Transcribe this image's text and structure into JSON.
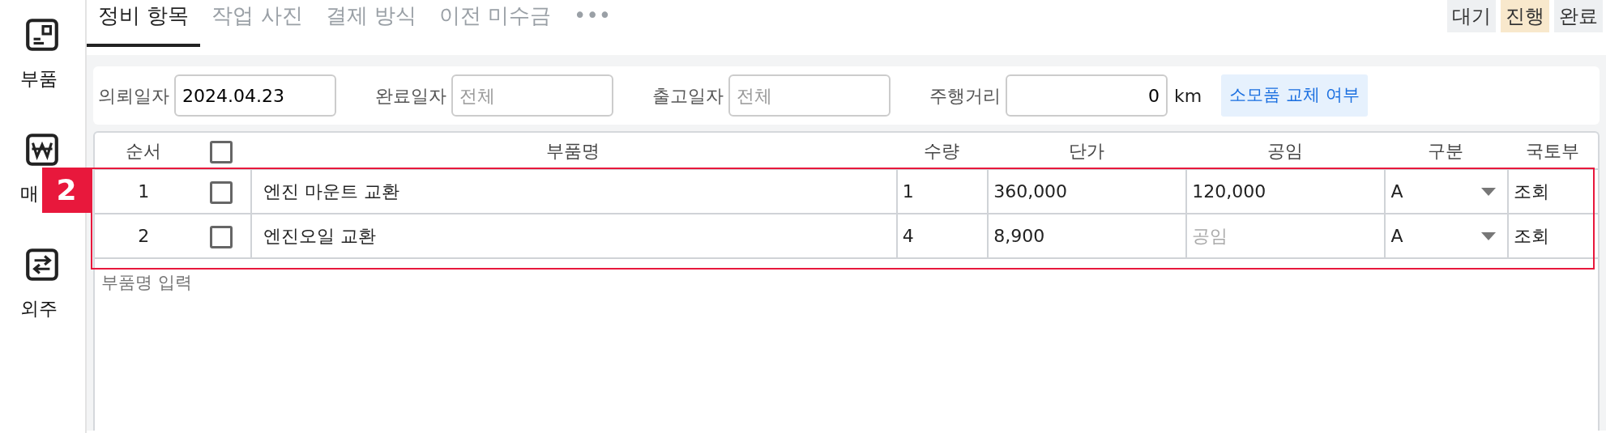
{
  "sidebar": {
    "items": [
      {
        "label": "부품",
        "kind": "part"
      },
      {
        "label": "매",
        "kind": "won"
      },
      {
        "label": "외주",
        "kind": "swap"
      }
    ]
  },
  "tabs": [
    {
      "label": "정비 항목",
      "selected": true
    },
    {
      "label": "작업 사진",
      "selected": false
    },
    {
      "label": "결제 방식",
      "selected": false
    },
    {
      "label": "이전 미수금",
      "selected": false
    },
    {
      "label": "•••",
      "selected": false
    }
  ],
  "status_buttons": [
    {
      "label": "대기",
      "selected": false
    },
    {
      "label": "진행",
      "selected": true
    },
    {
      "label": "완료",
      "selected": false
    }
  ],
  "filters": [
    {
      "label": "의뢰일자",
      "value": "2024.04.23"
    },
    {
      "label": "완료일자",
      "placeholder": "전체"
    },
    {
      "label": "출고일자",
      "placeholder": "전체"
    },
    {
      "label": "주행거리",
      "value": "0",
      "unit": "km"
    }
  ],
  "consumable_button": "소모품 교체 여부",
  "table": {
    "columns": [
      "순서",
      "부품명",
      "수량",
      "단가",
      "공임",
      "구분",
      "국토부"
    ],
    "header_checked": false,
    "rows": [
      {
        "order": "1",
        "checked": false,
        "name": "엔진 마운트 교환",
        "qty": "1",
        "price": "360,000",
        "labor": "120,000",
        "type": "A",
        "ministry": "조회"
      },
      {
        "order": "2",
        "checked": false,
        "name": "엔진오일 교환",
        "qty": "4",
        "price": "8,900",
        "labor_placeholder": "공임",
        "type": "A",
        "ministry": "조회"
      }
    ],
    "new_row_placeholder": "부품명 입력"
  },
  "annotation": {
    "label": "2"
  }
}
